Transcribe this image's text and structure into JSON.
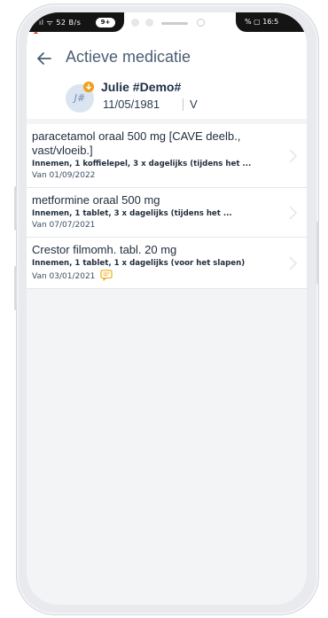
{
  "status_bar": {
    "left_text": "ıl ᯤ 52 B/s",
    "pill": "9+",
    "right_text": "% ▢ 16:5"
  },
  "header": {
    "title": "Actieve medicatie",
    "patient_name": "Julie #Demo#",
    "avatar_initials": "J#",
    "date_of_birth": "11/05/1981",
    "sex": "V"
  },
  "medications": [
    {
      "title": "paracetamol oraal 500 mg [CAVE deelb., vast/vloeib.]",
      "detail": "Innemen, 1 koffielepel, 3 x dagelijks (tijdens het ...",
      "date": "Van 01/09/2022",
      "has_note": false
    },
    {
      "title": "metformine oraal 500 mg",
      "detail": "Innemen, 1 tablet, 3 x dagelijks (tijdens het ...",
      "date": "Van 07/07/2021",
      "has_note": false
    },
    {
      "title": "Crestor filmomh. tabl. 20 mg",
      "detail": "Innemen, 1 tablet, 1 x dagelijks (voor het slapen)",
      "date": "Van 03/01/2021",
      "has_note": true
    }
  ],
  "colors": {
    "accent": "#4a5d74",
    "note_icon": "#f0b428",
    "avatar_badge": "#f0a020"
  },
  "icons": {
    "back": "arrow-left-icon",
    "chevron": "chevron-right-icon",
    "note": "comment-icon"
  }
}
